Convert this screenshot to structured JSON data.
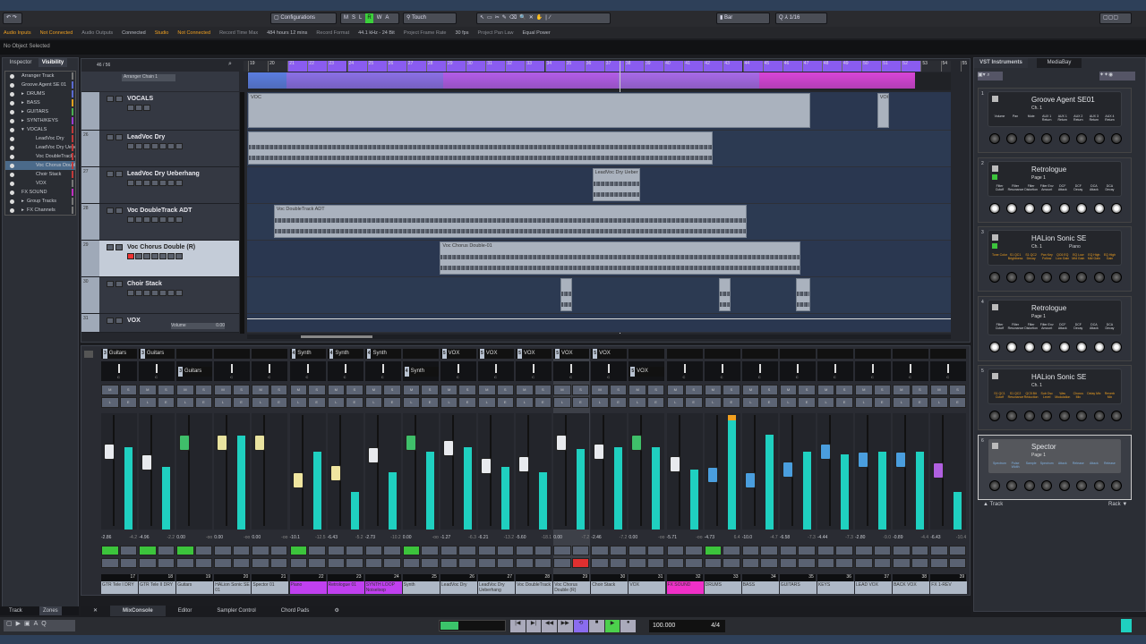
{
  "toolbar": {
    "configurations": "Configurations",
    "modes": [
      "M",
      "S",
      "L",
      "R",
      "W",
      "A"
    ],
    "automation": "Touch",
    "grid": "Bar",
    "quantize": "1/16"
  },
  "status": [
    {
      "label": "Audio Inputs",
      "value": "Not Connected",
      "warn": true
    },
    {
      "label": "Audio Outputs",
      "value": "Connected",
      "warn": false
    },
    {
      "label": "Studio",
      "value": "Not Connected",
      "warn": true
    },
    {
      "label": "Record Time Max",
      "value": "484 hours 12 mins",
      "warn": false
    },
    {
      "label": "Record Format",
      "value": "44.1 kHz - 24 Bit",
      "warn": false
    },
    {
      "label": "Project Frame Rate",
      "value": "30 fps",
      "warn": false
    },
    {
      "label": "Project Pan Law",
      "value": "Equal Power",
      "warn": false
    }
  ],
  "info": "No Object Selected",
  "left_zone": {
    "tabs": [
      "Inspector",
      "Visibility"
    ],
    "items": [
      {
        "label": "Arranger Track",
        "indent": 0,
        "color": "#777777"
      },
      {
        "label": "Groove Agent SE 01",
        "indent": 0,
        "color": "#5a6acf"
      },
      {
        "label": "DRUMS",
        "indent": 1,
        "folder": true,
        "color": "#5a6acf"
      },
      {
        "label": "BASS",
        "indent": 1,
        "folder": true,
        "color": "#e0a020"
      },
      {
        "label": "GUITARS",
        "indent": 1,
        "folder": true,
        "color": "#4caf50"
      },
      {
        "label": "SYNTH/KEYS",
        "indent": 1,
        "folder": true,
        "color": "#9c3cd0"
      },
      {
        "label": "VOCALS",
        "indent": 1,
        "folder": true,
        "open": true,
        "color": "#c03a3a"
      },
      {
        "label": "LeadVoc Dry",
        "indent": 2,
        "color": "#c03a3a"
      },
      {
        "label": "LeadVoc Dry Ueber",
        "indent": 2,
        "color": "#c03a3a"
      },
      {
        "label": "Voc DoubleTrack AI",
        "indent": 2,
        "color": "#c03a3a"
      },
      {
        "label": "Voc Chorus Double",
        "indent": 2,
        "color": "#c03a3a",
        "selected": true
      },
      {
        "label": "Choir Stack",
        "indent": 2,
        "color": "#c03a3a"
      },
      {
        "label": "VOX",
        "indent": 2,
        "color": "#777777"
      },
      {
        "label": "FX SOUND",
        "indent": 0,
        "color": "#c030c0"
      },
      {
        "label": "Group Tracks",
        "indent": 1,
        "folder": true,
        "color": "#777777"
      },
      {
        "label": "FX Channels",
        "indent": 1,
        "folder": true,
        "color": "#777777"
      }
    ],
    "bottom_tabs": [
      "Track",
      "Zones"
    ]
  },
  "project": {
    "counter": "46 / 56",
    "arranger_chain": "Arranger Chain 1",
    "bars": [
      19,
      20,
      21,
      22,
      23,
      24,
      25,
      26,
      27,
      28,
      29,
      30,
      31,
      32,
      33,
      34,
      35,
      36,
      37,
      38,
      39,
      40,
      41,
      42,
      43,
      44,
      45,
      46,
      47,
      48,
      49,
      50,
      51,
      52,
      53,
      54,
      55
    ],
    "cursor_bar": 37.8,
    "tracks": [
      {
        "num": "",
        "name": "VOCALS",
        "folder": true,
        "clips": [
          {
            "name": "",
            "start": 19,
            "end": 47.4,
            "label": "VOC"
          },
          {
            "name": "",
            "start": 50.8,
            "end": 51.4,
            "label": "VOC"
          }
        ]
      },
      {
        "num": "26",
        "name": "LeadVoc Dry",
        "clips": [
          {
            "name": "",
            "start": 19,
            "end": 42.5
          }
        ]
      },
      {
        "num": "27",
        "name": "LeadVoc Dry Ueberhang",
        "clips": [
          {
            "name": "LeadVoc Dry Ueber",
            "start": 36.4,
            "end": 38.8
          }
        ]
      },
      {
        "num": "28",
        "name": "Voc DoubleTrack ADT",
        "clips": [
          {
            "name": "Voc DoubleTrack ADT",
            "start": 20.3,
            "end": 44.2
          }
        ]
      },
      {
        "num": "29",
        "name": "Voc Chorus Double (R)",
        "selected": true,
        "clips": [
          {
            "name": "Voc Chorus Double-01",
            "start": 28.7,
            "end": 46.9
          }
        ]
      },
      {
        "num": "30",
        "name": "Choir Stack",
        "clips": [
          {
            "name": "",
            "start": 34.8,
            "end": 35.4
          },
          {
            "name": "",
            "start": 42.8,
            "end": 43.4
          },
          {
            "name": "",
            "start": 46.7,
            "end": 47.4
          }
        ]
      },
      {
        "num": "31",
        "name": "VOX",
        "clips": [],
        "volume_label": "Volume",
        "volume_value": "0.00"
      }
    ]
  },
  "mixer": {
    "channels": [
      {
        "num": "17",
        "name": "GTR Tele I DRY",
        "route": "Guitars",
        "rnum": "3",
        "vol": "-2.86",
        "peak": "-4.2",
        "cap": "#e8eaee",
        "meter": 0.72,
        "fader": 0.72,
        "mon": true
      },
      {
        "num": "18",
        "name": "GTR Tele II DRY",
        "route": "Guitars",
        "rnum": "3",
        "vol": "-4.96",
        "peak": "-2.2",
        "cap": "#e8eaee",
        "meter": 0.55,
        "fader": 0.62,
        "mon": true
      },
      {
        "num": "19",
        "name": "Guitars",
        "route2": "Guitars",
        "rnum": "3",
        "vol": "0.00",
        "peak": "-oo",
        "cap": "#3fbf6a",
        "meter": 0.0,
        "fader": 0.8,
        "mon": true
      },
      {
        "num": "20",
        "name": "HALion Sonic SE 01",
        "vol": "0.00",
        "peak": "-oo",
        "cap": "#e9e3a0",
        "meter": 0.82,
        "fader": 0.8
      },
      {
        "num": "21",
        "name": "Spector 01",
        "vol": "0.00",
        "peak": "-oo",
        "cap": "#e9e3a0",
        "meter": 0.0,
        "fader": 0.8
      },
      {
        "num": "22",
        "name": "Piano",
        "route": "Synth",
        "rnum": "4",
        "vol": "-10.1",
        "peak": "-12.5",
        "cap": "#f0e6a0",
        "meter": 0.68,
        "fader": 0.45,
        "mon": true,
        "hl": "#c040f0"
      },
      {
        "num": "23",
        "name": "Retrologue 01",
        "route": "Synth",
        "rnum": "4",
        "vol": "-6.43",
        "peak": "-5.2",
        "cap": "#f0e6a0",
        "meter": 0.33,
        "fader": 0.52,
        "hl": "#c040f0"
      },
      {
        "num": "24",
        "name": "SYNTH LOOP Noiseloop",
        "route": "Synth",
        "rnum": "4",
        "vol": "-2.73",
        "peak": "-10.2",
        "cap": "#e8eaee",
        "meter": 0.5,
        "fader": 0.68,
        "hl": "#c040f0"
      },
      {
        "num": "25",
        "name": "Synth",
        "route2": "Synth",
        "rnum": "4",
        "vol": "0.00",
        "peak": "-oo",
        "cap": "#3fbf6a",
        "meter": 0.68,
        "fader": 0.8,
        "mon": true
      },
      {
        "num": "26",
        "name": "LeadVoc Dry",
        "route": "VOX",
        "rnum": "5",
        "vol": "-1.27",
        "peak": "-6.3",
        "cap": "#e8eaee",
        "meter": 0.72,
        "fader": 0.75
      },
      {
        "num": "27",
        "name": "LeadVoc Dry Ueberhang",
        "route": "VOX",
        "rnum": "5",
        "vol": "-6.21",
        "peak": "-13.2",
        "cap": "#e8eaee",
        "meter": 0.55,
        "fader": 0.58
      },
      {
        "num": "28",
        "name": "Voc DoubleTrack",
        "route": "VOX",
        "rnum": "5",
        "vol": "-5.60",
        "peak": "-18.1",
        "cap": "#e8eaee",
        "meter": 0.5,
        "fader": 0.6
      },
      {
        "num": "29",
        "name": "Voc Chorus Double (R)",
        "route": "VOX",
        "rnum": "5",
        "vol": "0.00",
        "peak": "-7.2",
        "cap": "#e8eaee",
        "meter": 0.7,
        "fader": 0.8,
        "rec": true,
        "sel": true
      },
      {
        "num": "30",
        "name": "Choir Stack",
        "route": "VOX",
        "rnum": "5",
        "vol": "-2.46",
        "peak": "-7.2",
        "cap": "#e8eaee",
        "meter": 0.72,
        "fader": 0.72
      },
      {
        "num": "31",
        "name": "VOX",
        "route2": "VOX",
        "rnum": "5",
        "vol": "0.00",
        "peak": "-oo",
        "cap": "#3fbf6a",
        "meter": 0.72,
        "fader": 0.8
      },
      {
        "num": "32",
        "name": "FX SOUND",
        "vol": "-5.71",
        "peak": "-oo",
        "cap": "#e8eaee",
        "meter": 0.52,
        "fader": 0.6,
        "hl": "#f030c8"
      },
      {
        "num": "33",
        "name": "DRUMS",
        "vol": "-4.73",
        "peak": "6.4",
        "cap": "#4a9ede",
        "meter": 1.0,
        "fader": 0.5,
        "mon": true
      },
      {
        "num": "34",
        "name": "BASS",
        "vol": "-10.0",
        "peak": "-4.7",
        "cap": "#4a9ede",
        "meter": 0.83,
        "fader": 0.45
      },
      {
        "num": "35",
        "name": "GUITARS",
        "vol": "-6.58",
        "peak": "-7.3",
        "cap": "#4a9ede",
        "meter": 0.68,
        "fader": 0.55
      },
      {
        "num": "36",
        "name": "KEYS",
        "vol": "-4.44",
        "peak": "-7.3",
        "cap": "#4a9ede",
        "meter": 0.66,
        "fader": 0.72
      },
      {
        "num": "37",
        "name": "LEAD VOX",
        "vol": "-2.80",
        "peak": "-9.0",
        "cap": "#4a9ede",
        "meter": 0.68,
        "fader": 0.64
      },
      {
        "num": "38",
        "name": "BACK VOX",
        "vol": "-0.89",
        "peak": "-4.4",
        "cap": "#4a9ede",
        "meter": 0.68,
        "fader": 0.64
      },
      {
        "num": "39",
        "name": "FX 1-REV",
        "vol": "-6.43",
        "peak": "-10.4",
        "cap": "#b060e0",
        "meter": 0.33,
        "fader": 0.54
      }
    ]
  },
  "lower_tabs": [
    "MixConsole",
    "Editor",
    "Sampler Control",
    "Chord Pads"
  ],
  "transport": {
    "tempo": "100.000",
    "signature": "4/4"
  },
  "rack": {
    "tabs": [
      "VST Instruments",
      "MediaBay"
    ],
    "footer_left": "Track",
    "footer_right": "Rack",
    "instruments": [
      {
        "slot": "1",
        "title": "Groove Agent SE01",
        "sub": "Ch. 1",
        "params": [
          "Volume",
          "Pan",
          "Mute",
          "AUX 1 Return",
          "AUX 1 Return",
          "AUX 2 Return",
          "AUX 3 Return",
          "AUX 4 Return"
        ],
        "pcolor": "#d8dbe0"
      },
      {
        "slot": "2",
        "title": "Retrologue",
        "sub": "Page 1",
        "params": [
          "Filter Cutoff",
          "Filter Resonance",
          "Filter Distortion",
          "Filter Env Amount",
          "DCF Attack",
          "DCF Decay",
          "DCA Attack",
          "DCA Decay"
        ],
        "pcolor": "#d8dbe0"
      },
      {
        "slot": "3",
        "title": "HALion Sonic SE",
        "preset": "Piano",
        "sub": "Ch. 1",
        "params": [
          "Tone Color",
          "S1 QC1 Brightness",
          "S1 QC2 Decay",
          "Pan Key Follow",
          "QC6 EQ Low Gain",
          "EQ Low Mid Gain",
          "EQ High Mid Gain",
          "EQ High Gain"
        ],
        "pcolor": "#f0a020"
      },
      {
        "slot": "4",
        "title": "Retrologue",
        "sub": "Page 1",
        "params": [
          "Filter Cutoff",
          "Filter Resonance",
          "Filter Distortion",
          "Filter Env Amount",
          "DCF Attack",
          "DCF Decay",
          "DCA Attack",
          "DCA Decay"
        ],
        "pcolor": "#d8dbe0"
      },
      {
        "slot": "5",
        "title": "HALion Sonic SE",
        "sub": "Ch. 1",
        "params": [
          "S1 QC1 Cutoff",
          "S1 QC2 Resonance",
          "QC5 Bit Reduction",
          "Sub Osc Level",
          "Wav Modulation",
          "Chorus Mix",
          "Delay Mix",
          "Reverb Mix"
        ],
        "pcolor": "#f0a020"
      },
      {
        "slot": "6",
        "title": "Spector",
        "sub": "Page 1",
        "params": [
          "Spectrum",
          "Pulse Width",
          "Sample",
          "Spectrum",
          "Attack",
          "Release",
          "Attack",
          "Release"
        ],
        "pcolor": "#7fb0e0",
        "selected": true
      }
    ]
  }
}
